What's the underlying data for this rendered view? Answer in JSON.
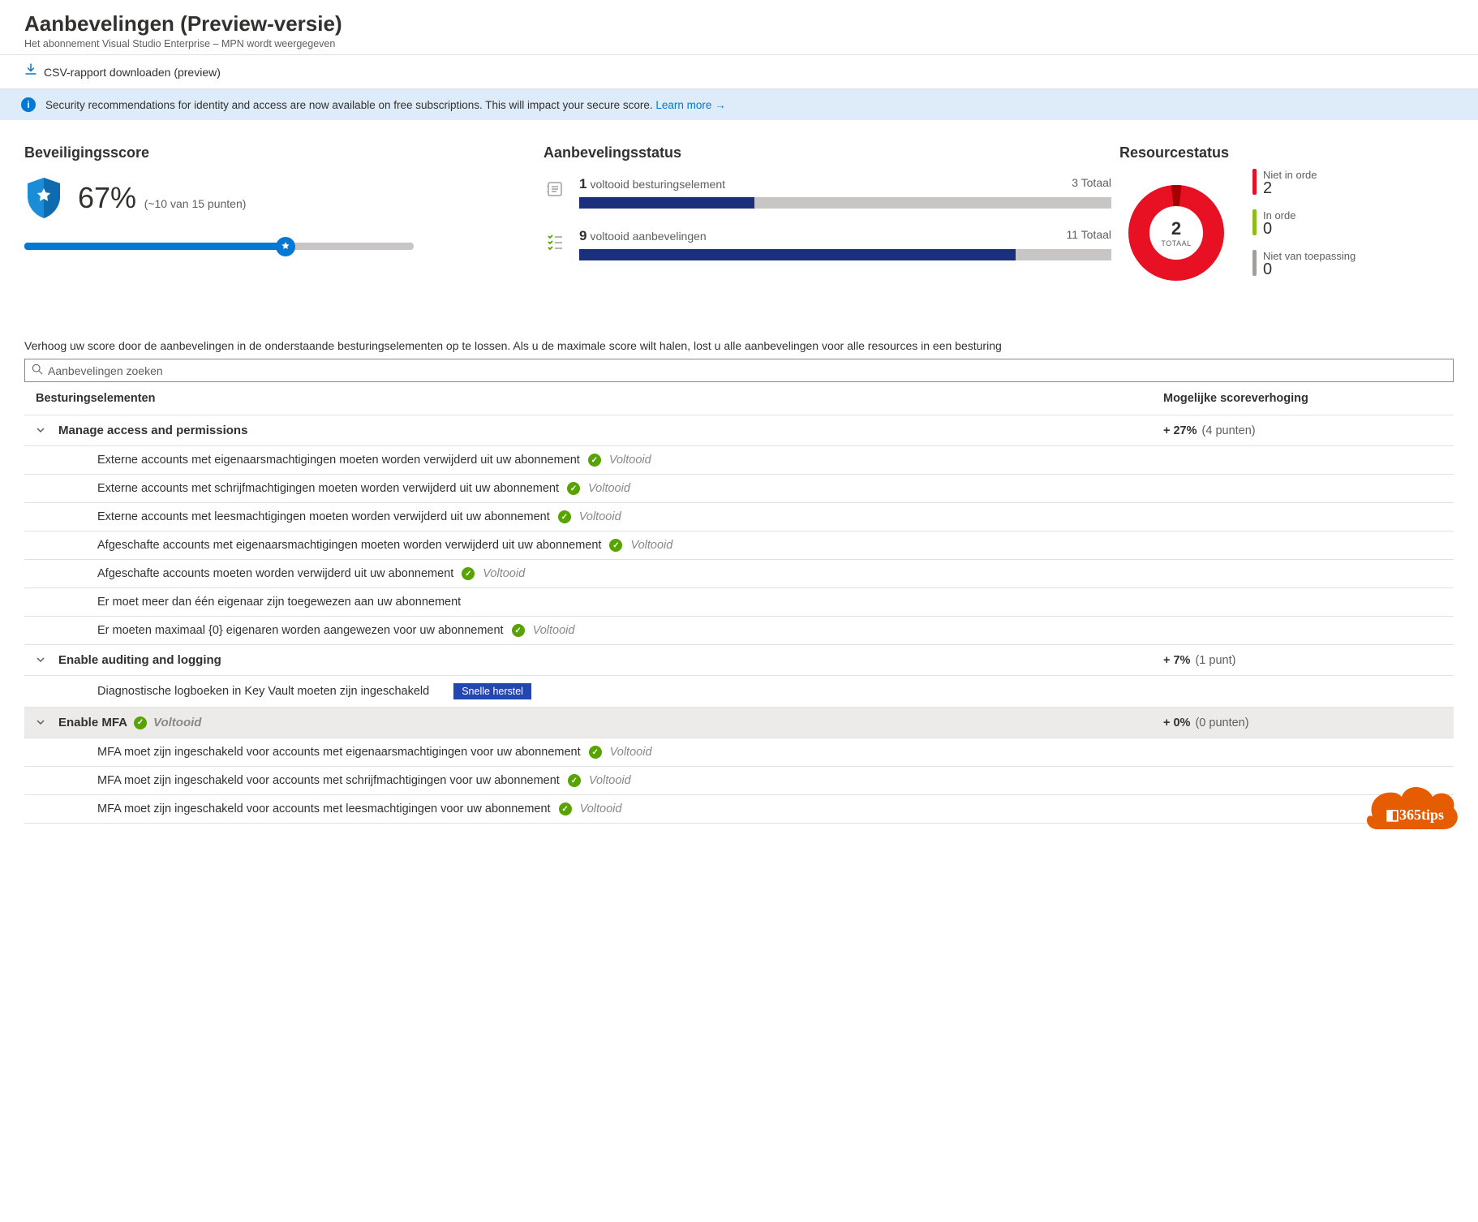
{
  "header": {
    "title": "Aanbevelingen (Preview-versie)",
    "subtitle": "Het abonnement Visual Studio Enterprise – MPN wordt weergegeven"
  },
  "toolbar": {
    "csv": "CSV-rapport downloaden (preview)"
  },
  "banner": {
    "text": "Security recommendations for identity and access are now available on free subscriptions. This will impact your secure score.",
    "learn_more": "Learn more"
  },
  "security_score": {
    "title": "Beveiligingsscore",
    "percent_label": "67%",
    "percent": 67,
    "points_label": "(~10 van 15 punten)"
  },
  "rec_status": {
    "title": "Aanbevelingsstatus",
    "controls": {
      "done": "1",
      "label": "voltooid besturingselement",
      "total": "3 Totaal",
      "pct": 33
    },
    "recs": {
      "done": "9",
      "label": "voltooid aanbevelingen",
      "total": "11 Totaal",
      "pct": 82
    }
  },
  "resource_status": {
    "title": "Resourcestatus",
    "total": "2",
    "total_label": "TOTAAL",
    "legend": [
      {
        "label": "Niet in orde",
        "value": "2",
        "color": "#e81123"
      },
      {
        "label": "In orde",
        "value": "0",
        "color": "#8cbd18"
      },
      {
        "label": "Niet van toepassing",
        "value": "0",
        "color": "#a19f9d"
      }
    ]
  },
  "intro": "Verhoog uw score door de aanbevelingen in de onderstaande besturingselementen op te lossen. Als u de maximale score wilt halen, lost u alle aanbevelingen voor alle resources in een besturing",
  "search": {
    "placeholder": "Aanbevelingen zoeken"
  },
  "table": {
    "col_controls": "Besturingselementen",
    "col_score": "Mogelijke scoreverhoging",
    "completed_label": "Voltooid",
    "quick_fix_label": "Snelle herstel",
    "groups": [
      {
        "name": "Manage access and permissions",
        "score": "+ 27%",
        "pts": "(4 punten)",
        "completed": false,
        "recs": [
          {
            "name": "Externe accounts met eigenaarsmachtigingen moeten worden verwijderd uit uw abonnement",
            "completed": true
          },
          {
            "name": "Externe accounts met schrijfmachtigingen moeten worden verwijderd uit uw abonnement",
            "completed": true
          },
          {
            "name": "Externe accounts met leesmachtigingen moeten worden verwijderd uit uw abonnement",
            "completed": true
          },
          {
            "name": "Afgeschafte accounts met eigenaarsmachtigingen moeten worden verwijderd uit uw abonnement",
            "completed": true
          },
          {
            "name": "Afgeschafte accounts moeten worden verwijderd uit uw abonnement",
            "completed": true
          },
          {
            "name": "Er moet meer dan één eigenaar zijn toegewezen aan uw abonnement",
            "completed": false
          },
          {
            "name": "Er moeten maximaal {0} eigenaren worden aangewezen voor uw abonnement",
            "completed": true
          }
        ]
      },
      {
        "name": "Enable auditing and logging",
        "score": "+ 7%",
        "pts": "(1 punt)",
        "completed": false,
        "recs": [
          {
            "name": "Diagnostische logboeken in Key Vault moeten zijn ingeschakeld",
            "completed": false,
            "quick_fix": true
          }
        ]
      },
      {
        "name": "Enable MFA",
        "score": "+ 0%",
        "pts": "(0 punten)",
        "completed": true,
        "highlight": true,
        "recs": [
          {
            "name": "MFA moet zijn ingeschakeld voor accounts met eigenaarsmachtigingen voor uw abonnement",
            "completed": true
          },
          {
            "name": "MFA moet zijn ingeschakeld voor accounts met schrijfmachtigingen voor uw abonnement",
            "completed": true
          },
          {
            "name": "MFA moet zijn ingeschakeld voor accounts met leesmachtigingen voor uw abonnement",
            "completed": true
          }
        ]
      }
    ]
  },
  "footer_logo": "365tips"
}
